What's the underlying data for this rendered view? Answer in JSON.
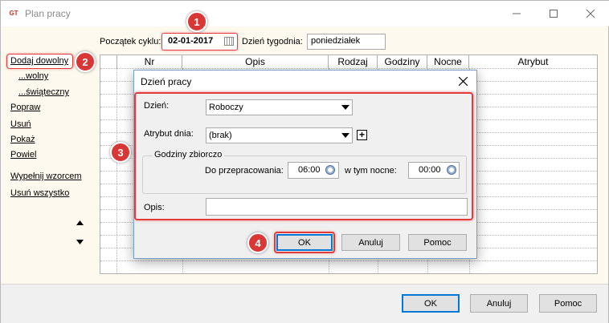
{
  "window": {
    "title": "Plan pracy",
    "app_icon": "GT"
  },
  "top": {
    "start_label": "Początek cyklu:",
    "start_value": "02-01-2017",
    "weekday_label": "Dzień tygodnia:",
    "weekday_value": "poniedziałek"
  },
  "links": {
    "add_any": "Dodaj dowolny",
    "free": "...wolny",
    "holiday": "...świąteczny",
    "edit": "Popraw",
    "delete": "Usuń",
    "show": "Pokaż",
    "repeat": "Powiel",
    "fill_pattern": "Wypełnij wzorcem",
    "delete_all": "Usuń wszystko"
  },
  "grid": {
    "headers": [
      "Nr",
      "Opis",
      "Rodzaj",
      "Godziny",
      "Nocne",
      "Atrybut"
    ]
  },
  "bottom": {
    "ok": "OK",
    "cancel": "Anuluj",
    "help": "Pomoc"
  },
  "dialog": {
    "title": "Dzień pracy",
    "day_label": "Dzień:",
    "day_value": "Roboczy",
    "attr_label": "Atrybut dnia:",
    "attr_value": "(brak)",
    "attr_add": "+",
    "group_title": "Godziny zbiorczo",
    "work_label": "Do przepracowania:",
    "work_value": "06:00",
    "night_label": "w tym nocne:",
    "night_value": "00:00",
    "desc_label": "Opis:",
    "desc_value": "",
    "ok": "OK",
    "cancel": "Anuluj",
    "help": "Pomoc"
  },
  "badges": [
    "1",
    "2",
    "3",
    "4"
  ],
  "colors": {
    "highlight": "#e03a3a",
    "badge": "#d93636"
  }
}
